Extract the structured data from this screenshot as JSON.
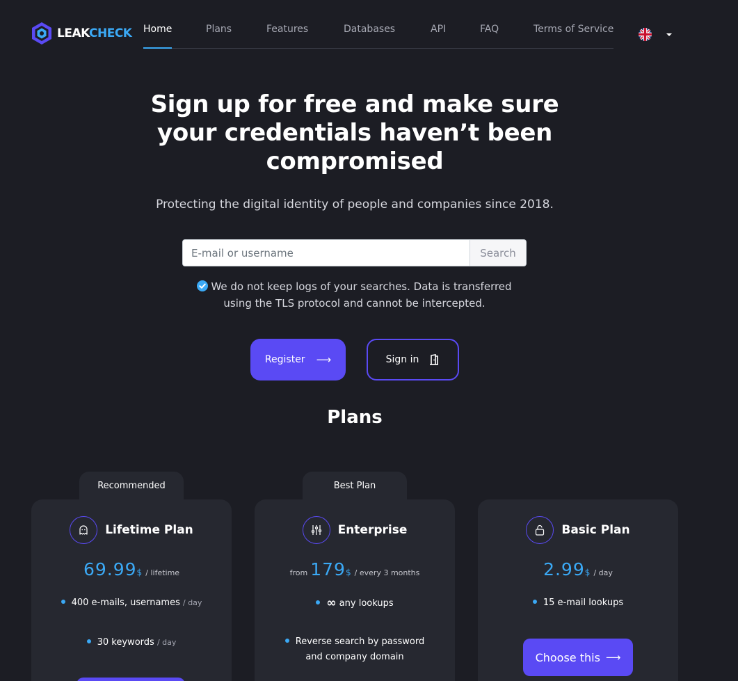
{
  "nav": {
    "logo_leak": "LEAK",
    "logo_check": "CHECK",
    "items": [
      {
        "label": "Home",
        "active": true
      },
      {
        "label": "Plans"
      },
      {
        "label": "Features"
      },
      {
        "label": "Databases"
      },
      {
        "label": "API"
      },
      {
        "label": "FAQ"
      },
      {
        "label": "Terms of Service"
      }
    ],
    "language_icon": "uk-flag-icon"
  },
  "hero": {
    "title": "Sign up for free and make sure your credentials haven’t been compromised",
    "subtitle": "Protecting the digital identity of people and companies since 2018.",
    "search_placeholder": "E-mail or username",
    "search_button": "Search",
    "privacy_note": "We do not keep logs of your searches. Data is transferred using the TLS protocol and cannot be intercepted.",
    "register_label": "Register",
    "signin_label": "Sign in"
  },
  "plans": {
    "heading": "Plans",
    "cards": [
      {
        "tag": "Recommended",
        "name": "Lifetime Plan",
        "icon": "ghost-icon",
        "price": "69.99",
        "currency": "$",
        "period": "/ lifetime",
        "features": [
          {
            "text": "400 e-mails, usernames",
            "unit": "/ day"
          },
          {
            "text": "30 keywords",
            "unit": "/ day"
          }
        ]
      },
      {
        "tag": "Best Plan",
        "name": "Enterprise",
        "icon": "sliders-icon",
        "price_prefix": "from",
        "price": "179",
        "currency": "$",
        "period": "/ every 3 months",
        "features": [
          {
            "symbol": "∞",
            "text": "any lookups"
          },
          {
            "text": "Reverse search by password and company domain"
          }
        ]
      },
      {
        "name": "Basic Plan",
        "icon": "lock-icon",
        "price": "2.99",
        "currency": "$",
        "period": "/ day",
        "features": [
          {
            "text": "15 e-mail lookups"
          }
        ],
        "button": "Choose this"
      }
    ]
  },
  "colors": {
    "background": "#1c1d24",
    "card": "#262830",
    "accent": "#5a4af4",
    "highlight": "#3ba9f5"
  }
}
